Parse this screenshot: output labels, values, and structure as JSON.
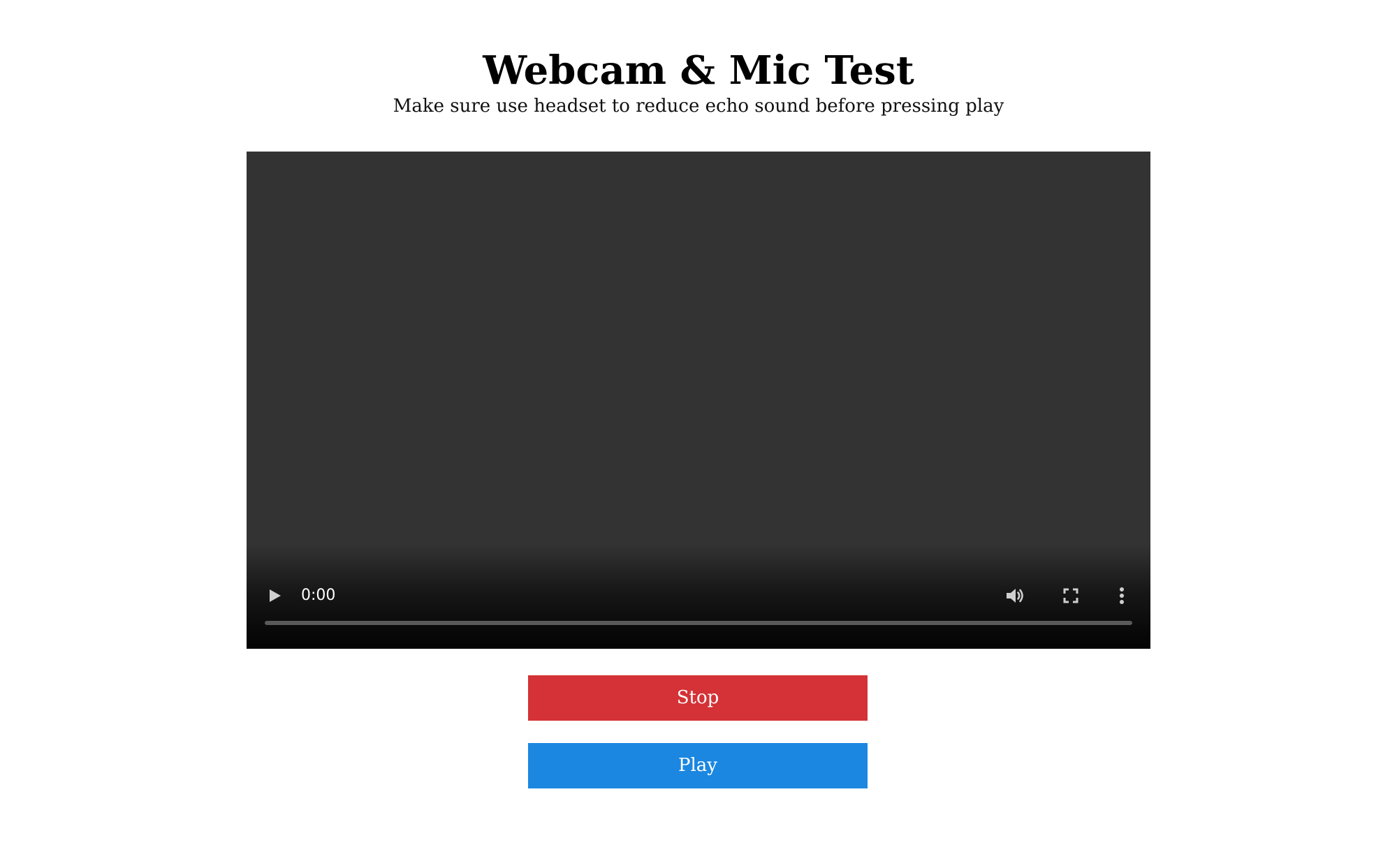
{
  "header": {
    "title": "Webcam & Mic Test",
    "subtitle": "Make sure use headset to reduce echo sound before pressing play"
  },
  "video_player": {
    "current_time": "0:00",
    "progress": 0,
    "icons": {
      "play": "play-icon",
      "volume": "volume-icon",
      "fullscreen": "fullscreen-icon",
      "menu": "more-vertical-icon"
    }
  },
  "buttons": {
    "stop_label": "Stop",
    "play_label": "Play"
  },
  "colors": {
    "stop": "#d43237",
    "play": "#1b87e0",
    "video_background": "#333333"
  }
}
